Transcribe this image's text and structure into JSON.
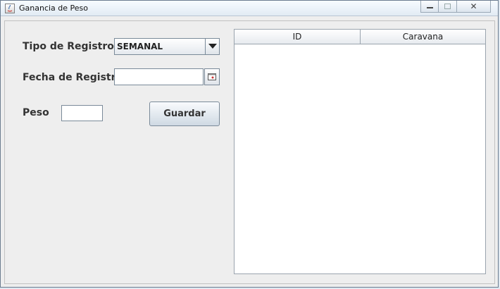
{
  "window": {
    "title": "Ganancia de Peso"
  },
  "form": {
    "tipo_label": "Tipo de Registro",
    "tipo_value": "SEMANAL",
    "fecha_label": "Fecha de Registro",
    "fecha_value": "",
    "peso_label": "Peso",
    "peso_value": "",
    "guardar_label": "Guardar"
  },
  "table": {
    "columns": [
      "ID",
      "Caravana"
    ],
    "rows": []
  }
}
